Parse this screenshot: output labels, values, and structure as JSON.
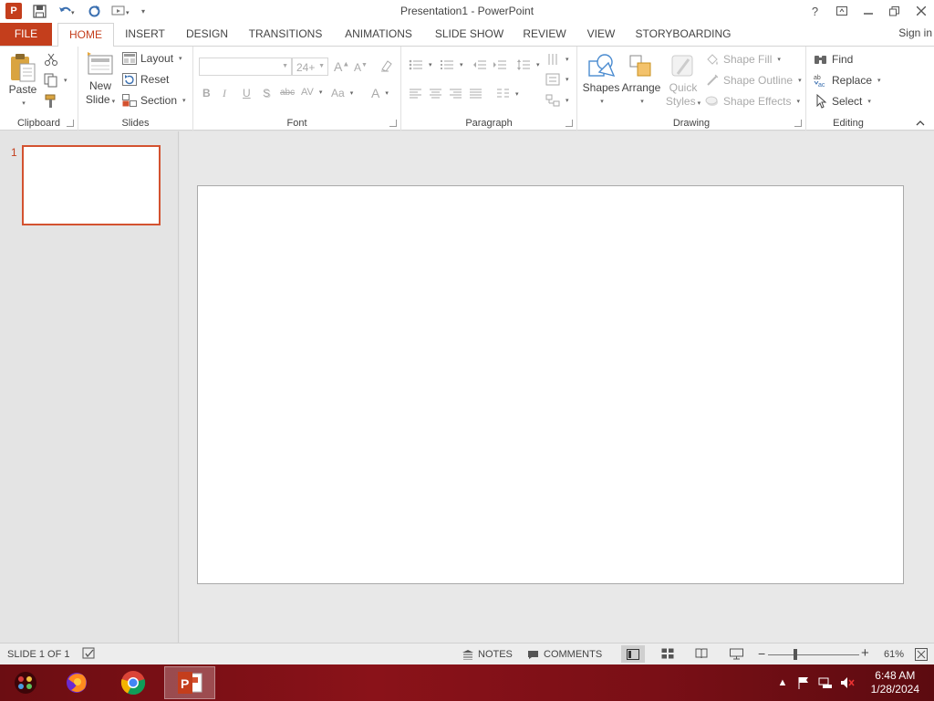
{
  "window": {
    "title": "Presentation1 - PowerPoint",
    "help": "?",
    "signin": "Sign in"
  },
  "tabs": [
    "FILE",
    "HOME",
    "INSERT",
    "DESIGN",
    "TRANSITIONS",
    "ANIMATIONS",
    "SLIDE SHOW",
    "REVIEW",
    "VIEW",
    "STORYBOARDING"
  ],
  "ribbon": {
    "clipboard": {
      "label": "Clipboard",
      "paste": "Paste"
    },
    "slides": {
      "label": "Slides",
      "new_slide_1": "New",
      "new_slide_2": "Slide",
      "layout": "Layout",
      "reset": "Reset",
      "section": "Section"
    },
    "font": {
      "label": "Font",
      "size": "24+"
    },
    "paragraph": {
      "label": "Paragraph"
    },
    "drawing": {
      "label": "Drawing",
      "shapes": "Shapes",
      "arrange": "Arrange",
      "quick_styles_1": "Quick",
      "quick_styles_2": "Styles",
      "shape_fill": "Shape Fill",
      "shape_outline": "Shape Outline",
      "shape_effects": "Shape Effects"
    },
    "editing": {
      "label": "Editing",
      "find": "Find",
      "replace": "Replace",
      "select": "Select"
    }
  },
  "thumbnails": {
    "number": "1"
  },
  "status": {
    "slide_info": "SLIDE 1 OF 1",
    "notes": "NOTES",
    "comments": "COMMENTS",
    "zoom": "61%"
  },
  "taskbar": {
    "time": "6:48 AM",
    "date": "1/28/2024"
  },
  "colors": {
    "accent": "#c43e1c",
    "taskbar": "#7a0f16"
  }
}
